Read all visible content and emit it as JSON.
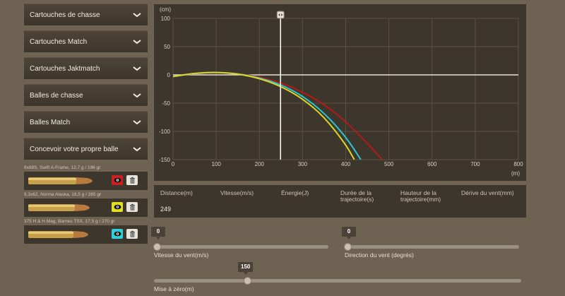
{
  "accordion": [
    {
      "label": "Cartouches de chasse"
    },
    {
      "label": "Cartouches Match"
    },
    {
      "label": "Cartouches Jaktmatch"
    },
    {
      "label": "Balles de chasse"
    },
    {
      "label": "Balles Match"
    },
    {
      "label": "Concevoir votre propre balle"
    }
  ],
  "ammo": [
    {
      "label": "8x68S, Swift A-Frame, 12,7 g / 196 gr",
      "color": "#cc1f1f",
      "icon": "eye-icon"
    },
    {
      "label": "9,3x62, Norma Alaska, 18,5 g / 285 gr",
      "color": "#e5e01f",
      "icon": "eye-icon"
    },
    {
      "label": "375 H & H Mag, Barnes TSX, 17,5 g / 270 gr",
      "color": "#2fd0dc",
      "icon": "eye-icon"
    }
  ],
  "chart_data": {
    "type": "line",
    "ylabel": "(cm)",
    "xlabel": "(m)",
    "xlim": [
      0,
      800
    ],
    "ylim": [
      -150,
      100
    ],
    "x_ticks": [
      0,
      100,
      200,
      300,
      400,
      500,
      600,
      700,
      800
    ],
    "y_ticks": [
      100,
      50,
      0,
      -50,
      -100,
      -150
    ],
    "cursor_x": 249,
    "grid": true,
    "series": [
      {
        "color": "#b31a1a",
        "x": [
          0,
          50,
          100,
          150,
          200,
          250,
          300,
          350,
          400,
          450,
          485
        ],
        "y": [
          -3,
          2.5,
          4.5,
          2.5,
          -3.5,
          -14,
          -30,
          -52,
          -82,
          -121,
          -150
        ]
      },
      {
        "color": "#29c6d2",
        "x": [
          0,
          50,
          100,
          150,
          200,
          250,
          300,
          350,
          400,
          435
        ],
        "y": [
          -3,
          2.8,
          4.6,
          2.2,
          -5,
          -17,
          -37,
          -67,
          -109,
          -150
        ]
      },
      {
        "color": "#dcd426",
        "x": [
          0,
          50,
          100,
          150,
          200,
          250,
          300,
          350,
          400,
          420
        ],
        "y": [
          -3,
          3.2,
          5,
          2,
          -6,
          -20,
          -42,
          -74,
          -123,
          -150
        ]
      }
    ]
  },
  "table": {
    "headers": [
      "Distance(m)",
      "Vitesse(m/s)",
      "Énergie(J)",
      "Durée de la trajectoire(s)",
      "Hauteur de la trajectoire(mm)",
      "Dérive du vent(mm)"
    ],
    "distance_value": "249"
  },
  "sliders": {
    "wind_speed": {
      "value": "0",
      "label": "Vitesse du vent(m/s)",
      "fraction": 0
    },
    "wind_dir": {
      "value": "0",
      "label": "Direction du vent (degrés)",
      "fraction": 0
    },
    "zero": {
      "value": "150",
      "label": "Mise à zéro(m)",
      "fraction": 0.25
    }
  }
}
